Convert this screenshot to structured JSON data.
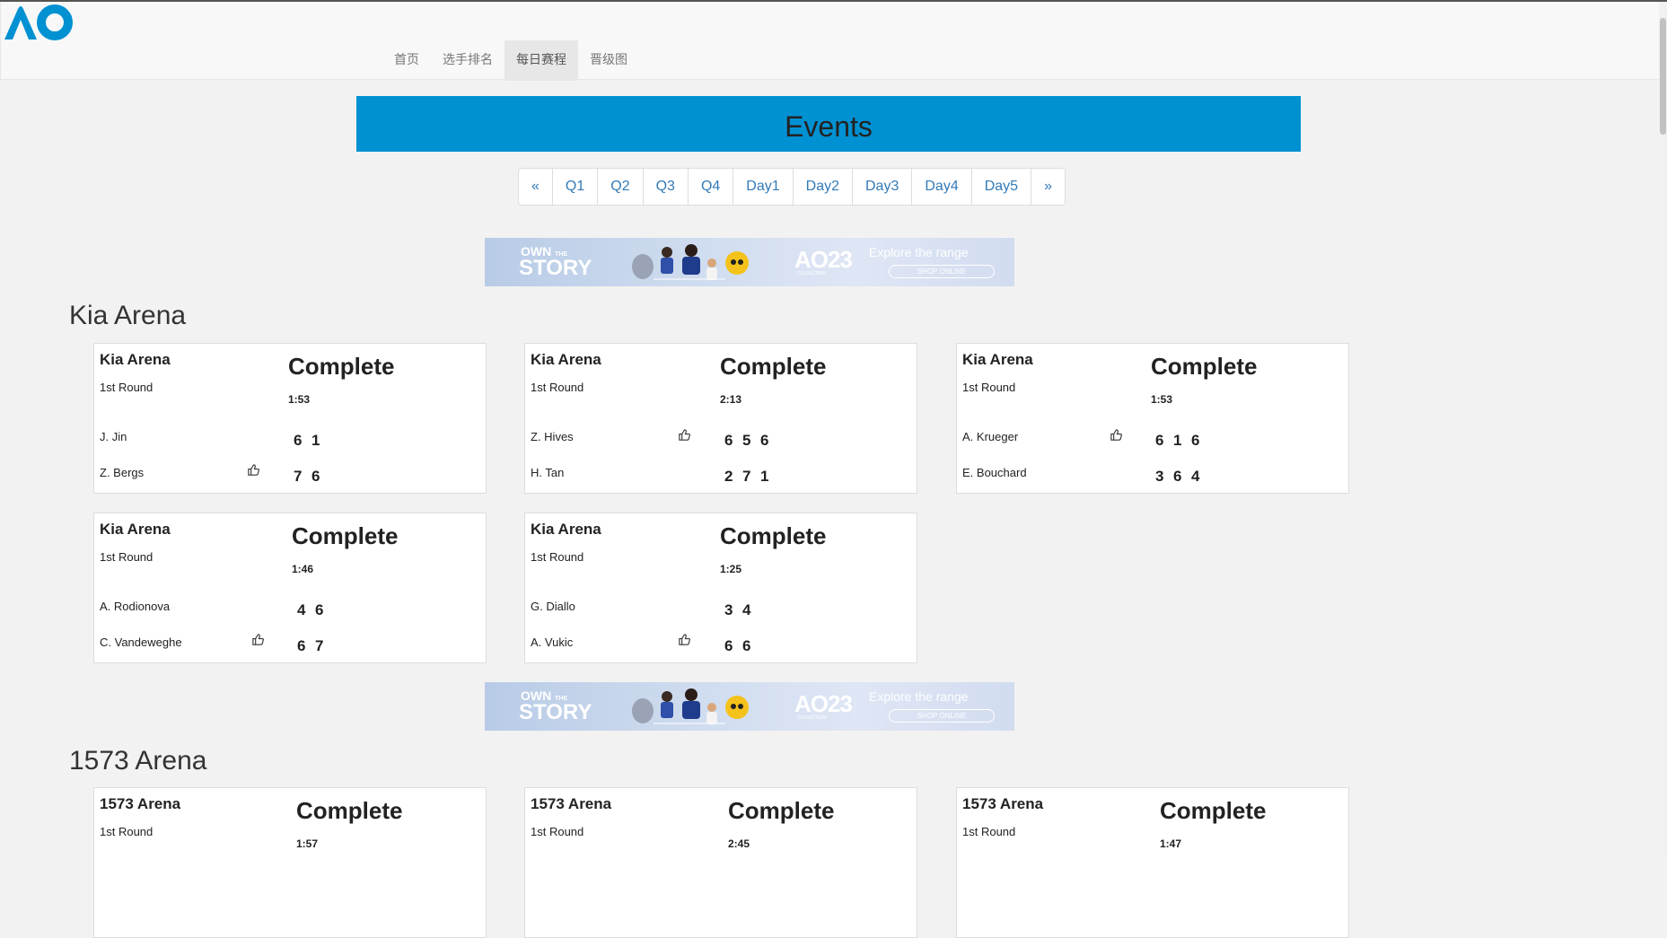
{
  "nav": {
    "items": [
      {
        "label": "首页",
        "active": false
      },
      {
        "label": "选手排名",
        "active": false
      },
      {
        "label": "每日赛程",
        "active": true
      },
      {
        "label": "晋级图",
        "active": false
      }
    ]
  },
  "banner": {
    "title": "Events"
  },
  "pagination": [
    "«",
    "Q1",
    "Q2",
    "Q3",
    "Q4",
    "Day1",
    "Day2",
    "Day3",
    "Day4",
    "Day5",
    "»"
  ],
  "ad": {
    "own": "OWN",
    "the": "THE",
    "story": "STORY",
    "brand": "AO23",
    "brand_sub": "COLLECTION",
    "explore": "Explore the range",
    "shop": "SHOP ONLINE"
  },
  "sections": [
    {
      "title": "Kia Arena",
      "matches": [
        {
          "venue": "Kia Arena",
          "round": "1st Round",
          "status": "Complete",
          "duration": "1:53",
          "p1": {
            "name": "J. Jin",
            "winner": false,
            "sets": [
              "6",
              "1"
            ]
          },
          "p2": {
            "name": "Z. Bergs",
            "winner": true,
            "sets": [
              "7",
              "6"
            ]
          }
        },
        {
          "venue": "Kia Arena",
          "round": "1st Round",
          "status": "Complete",
          "duration": "2:13",
          "p1": {
            "name": "Z. Hives",
            "winner": true,
            "sets": [
              "6",
              "5",
              "6"
            ]
          },
          "p2": {
            "name": "H. Tan",
            "winner": false,
            "sets": [
              "2",
              "7",
              "1"
            ]
          }
        },
        {
          "venue": "Kia Arena",
          "round": "1st Round",
          "status": "Complete",
          "duration": "1:53",
          "p1": {
            "name": "A. Krueger",
            "winner": true,
            "sets": [
              "6",
              "1",
              "6"
            ]
          },
          "p2": {
            "name": "E. Bouchard",
            "winner": false,
            "sets": [
              "3",
              "6",
              "4"
            ]
          }
        },
        {
          "venue": "Kia Arena",
          "round": "1st Round",
          "status": "Complete",
          "duration": "1:46",
          "p1": {
            "name": "A. Rodionova",
            "winner": false,
            "sets": [
              "4",
              "6"
            ]
          },
          "p2": {
            "name": "C. Vandeweghe",
            "winner": true,
            "sets": [
              "6",
              "7"
            ]
          }
        },
        {
          "venue": "Kia Arena",
          "round": "1st Round",
          "status": "Complete",
          "duration": "1:25",
          "p1": {
            "name": "G. Diallo",
            "winner": false,
            "sets": [
              "3",
              "4"
            ]
          },
          "p2": {
            "name": "A. Vukic",
            "winner": true,
            "sets": [
              "6",
              "6"
            ]
          }
        }
      ]
    },
    {
      "title": "1573 Arena",
      "matches": [
        {
          "venue": "1573 Arena",
          "round": "1st Round",
          "status": "Complete",
          "duration": "1:57"
        },
        {
          "venue": "1573 Arena",
          "round": "1st Round",
          "status": "Complete",
          "duration": "2:45"
        },
        {
          "venue": "1573 Arena",
          "round": "1st Round",
          "status": "Complete",
          "duration": "1:47"
        }
      ]
    }
  ],
  "colors": {
    "accent": "#0091d2",
    "link": "#337ab7",
    "background": "#f2f2f2"
  }
}
